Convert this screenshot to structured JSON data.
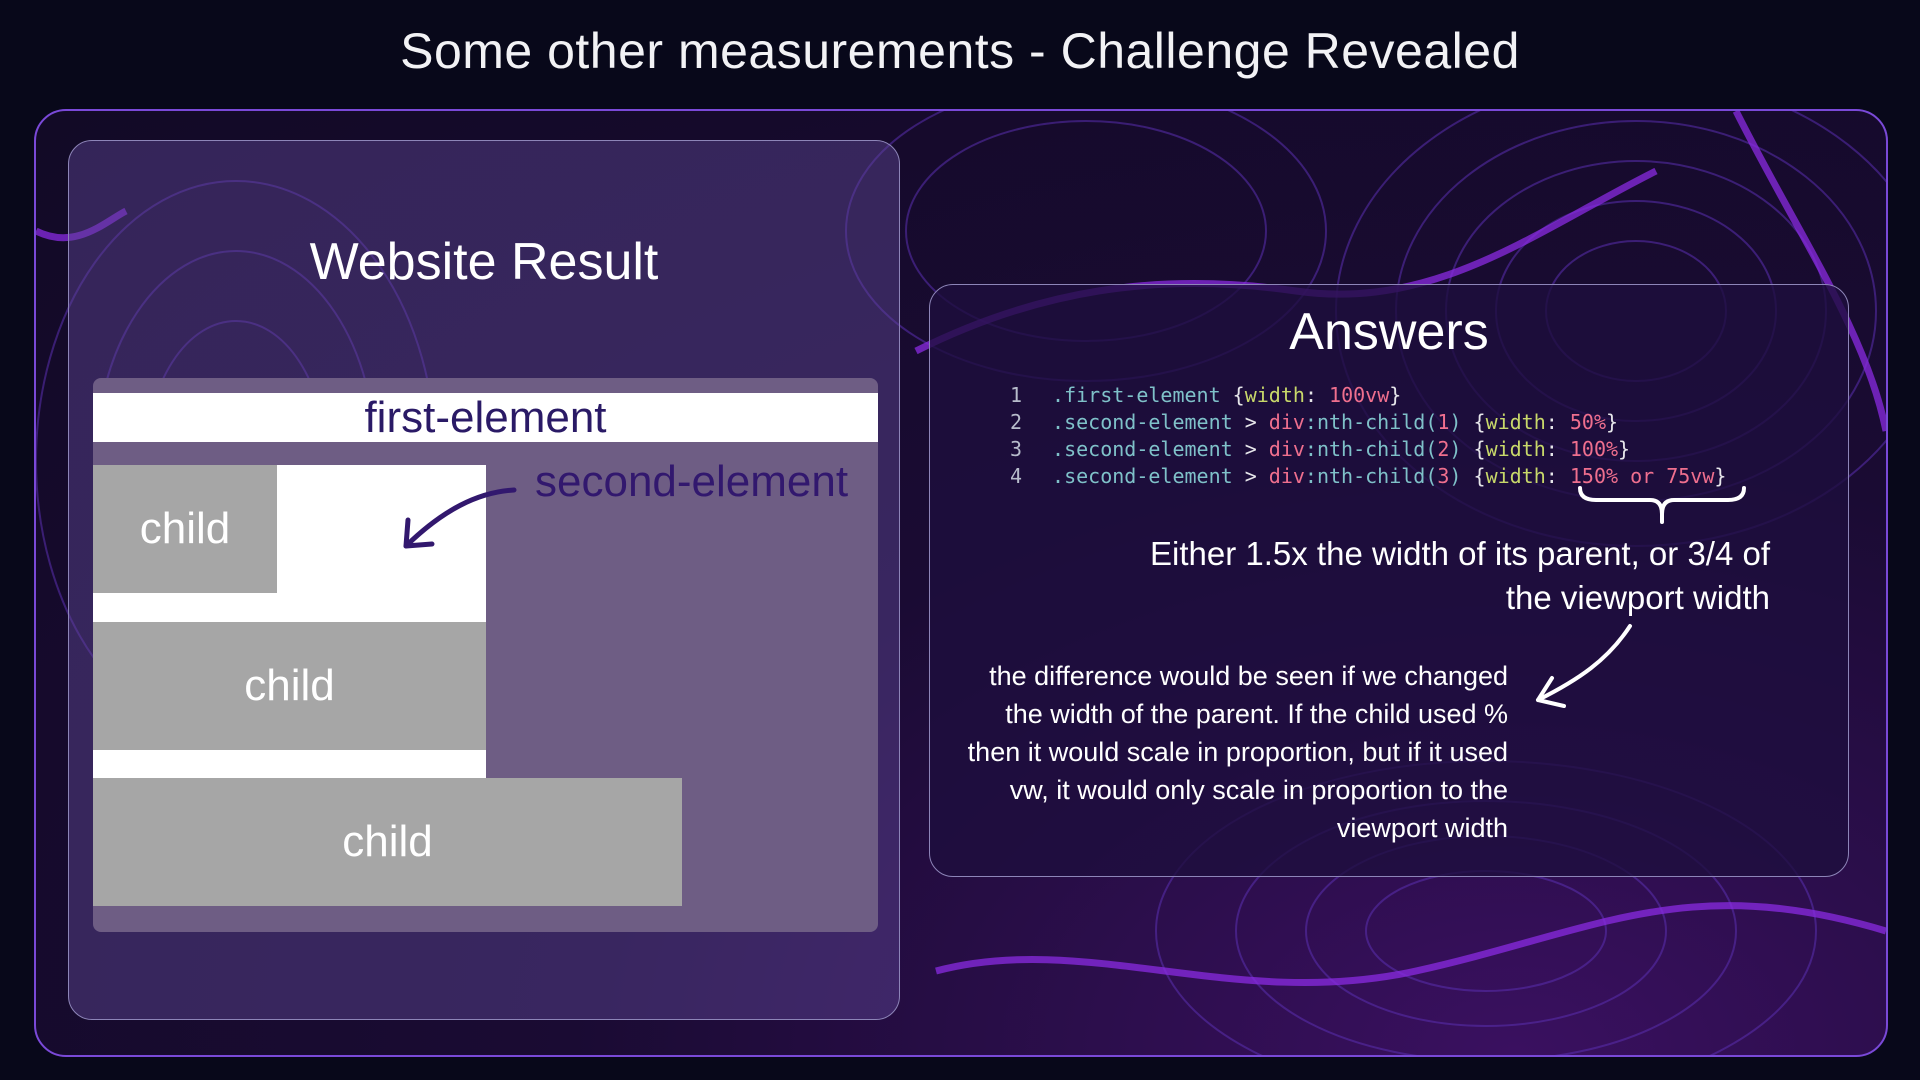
{
  "page_title": "Some other measurements - Challenge Revealed",
  "result_panel": {
    "title": "Website Result",
    "first_element_label": "first-element",
    "second_element_label": "second-element",
    "child_labels": [
      "child",
      "child",
      "child"
    ]
  },
  "answers_panel": {
    "title": "Answers",
    "code_lines": [
      {
        "num": "1",
        "selector": ".first-element",
        "rest": "",
        "arg": "",
        "prop": "width",
        "value": "100vw"
      },
      {
        "num": "2",
        "selector": ".second-element",
        "rest": " > ",
        "tag": "div",
        "pseudo": ":nth-child(",
        "arg": "1",
        "prop": "width",
        "value": "50%"
      },
      {
        "num": "3",
        "selector": ".second-element",
        "rest": " > ",
        "tag": "div",
        "pseudo": ":nth-child(",
        "arg": "2",
        "prop": "width",
        "value": "100%"
      },
      {
        "num": "4",
        "selector": ".second-element",
        "rest": " > ",
        "tag": "div",
        "pseudo": ":nth-child(",
        "arg": "3",
        "prop": "width",
        "value": "150% or 75vw"
      }
    ],
    "main_note": "Either 1.5x the width of its parent, or 3/4 of the viewport width",
    "detail_note": "the difference would be seen if we changed the width of the parent. If the child used % then it would scale in proportion, but if it used vw, it would only scale in proportion to the viewport width"
  },
  "colors": {
    "frame_border": "#7a49d8",
    "panel_border": "#8d85b8",
    "child_fill": "#a6a6a6",
    "label_purple": "#32186e"
  }
}
